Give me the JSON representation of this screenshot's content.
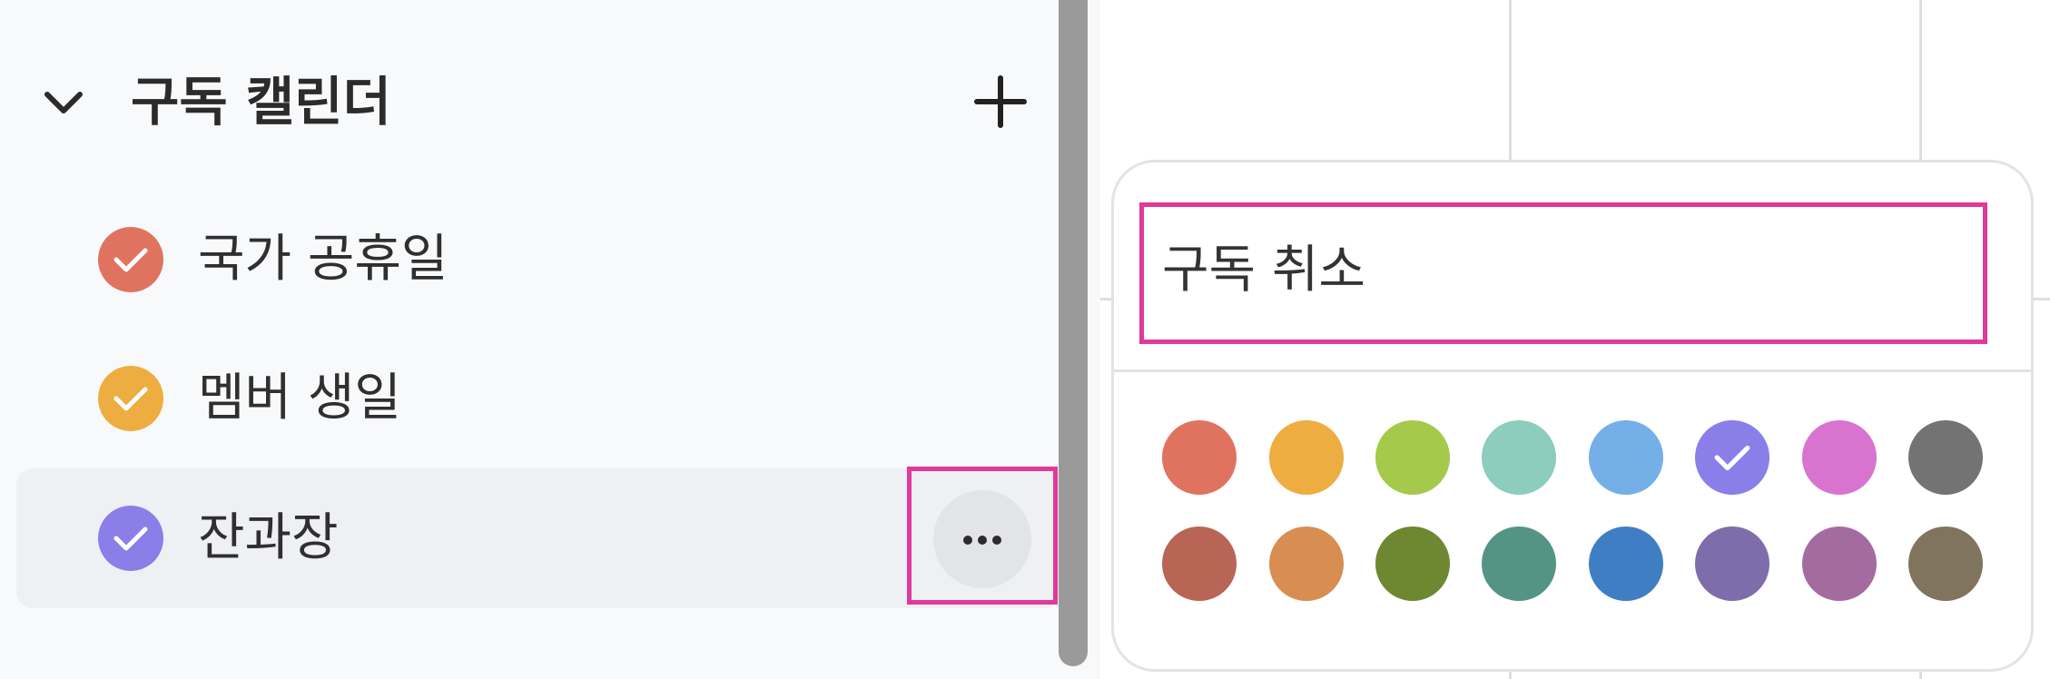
{
  "sidebar": {
    "section_title": "구독 캘린더",
    "calendars": [
      {
        "label": "국가 공휴일",
        "color": "#e0735f",
        "checked": true
      },
      {
        "label": "멤버 생일",
        "color": "#edad40",
        "checked": true
      },
      {
        "label": "잔과장",
        "color": "#8a7ee8",
        "checked": true
      }
    ]
  },
  "popover": {
    "unsubscribe_label": "구독 취소",
    "colors": [
      {
        "hex": "#e0735f",
        "selected": false
      },
      {
        "hex": "#edad40",
        "selected": false
      },
      {
        "hex": "#a5c94b",
        "selected": false
      },
      {
        "hex": "#8ccdbd",
        "selected": false
      },
      {
        "hex": "#74afe8",
        "selected": false
      },
      {
        "hex": "#8a7ee8",
        "selected": true
      },
      {
        "hex": "#d874cf",
        "selected": false
      },
      {
        "hex": "#737373",
        "selected": false
      },
      {
        "hex": "#b86556",
        "selected": false
      },
      {
        "hex": "#d78e50",
        "selected": false
      },
      {
        "hex": "#6e8731",
        "selected": false
      },
      {
        "hex": "#549484",
        "selected": false
      },
      {
        "hex": "#3f7ec3",
        "selected": false
      },
      {
        "hex": "#7e6cab",
        "selected": false
      },
      {
        "hex": "#a46ba0",
        "selected": false
      },
      {
        "hex": "#80745f",
        "selected": false
      }
    ]
  },
  "icons": {
    "section_toggle": "chevron-down-icon",
    "add": "plus-icon",
    "more": "more-horizontal-icon",
    "check": "check-icon"
  }
}
